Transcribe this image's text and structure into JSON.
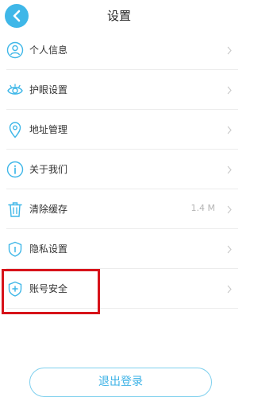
{
  "header": {
    "title": "设置",
    "accent_color": "#3fb7e8"
  },
  "settings": {
    "items": [
      {
        "label": "个人信息",
        "icon": "user-icon",
        "value": ""
      },
      {
        "label": "护眼设置",
        "icon": "eye-icon",
        "value": ""
      },
      {
        "label": "地址管理",
        "icon": "location-pin-icon",
        "value": ""
      },
      {
        "label": "关于我们",
        "icon": "info-icon",
        "value": ""
      },
      {
        "label": "清除缓存",
        "icon": "trash-icon",
        "value": "1.4 M"
      },
      {
        "label": "隐私设置",
        "icon": "shield-icon",
        "value": ""
      },
      {
        "label": "账号安全",
        "icon": "shield-plus-icon",
        "value": ""
      }
    ]
  },
  "highlight": {
    "color": "#d7131a"
  },
  "footer": {
    "logout_label": "退出登录"
  }
}
